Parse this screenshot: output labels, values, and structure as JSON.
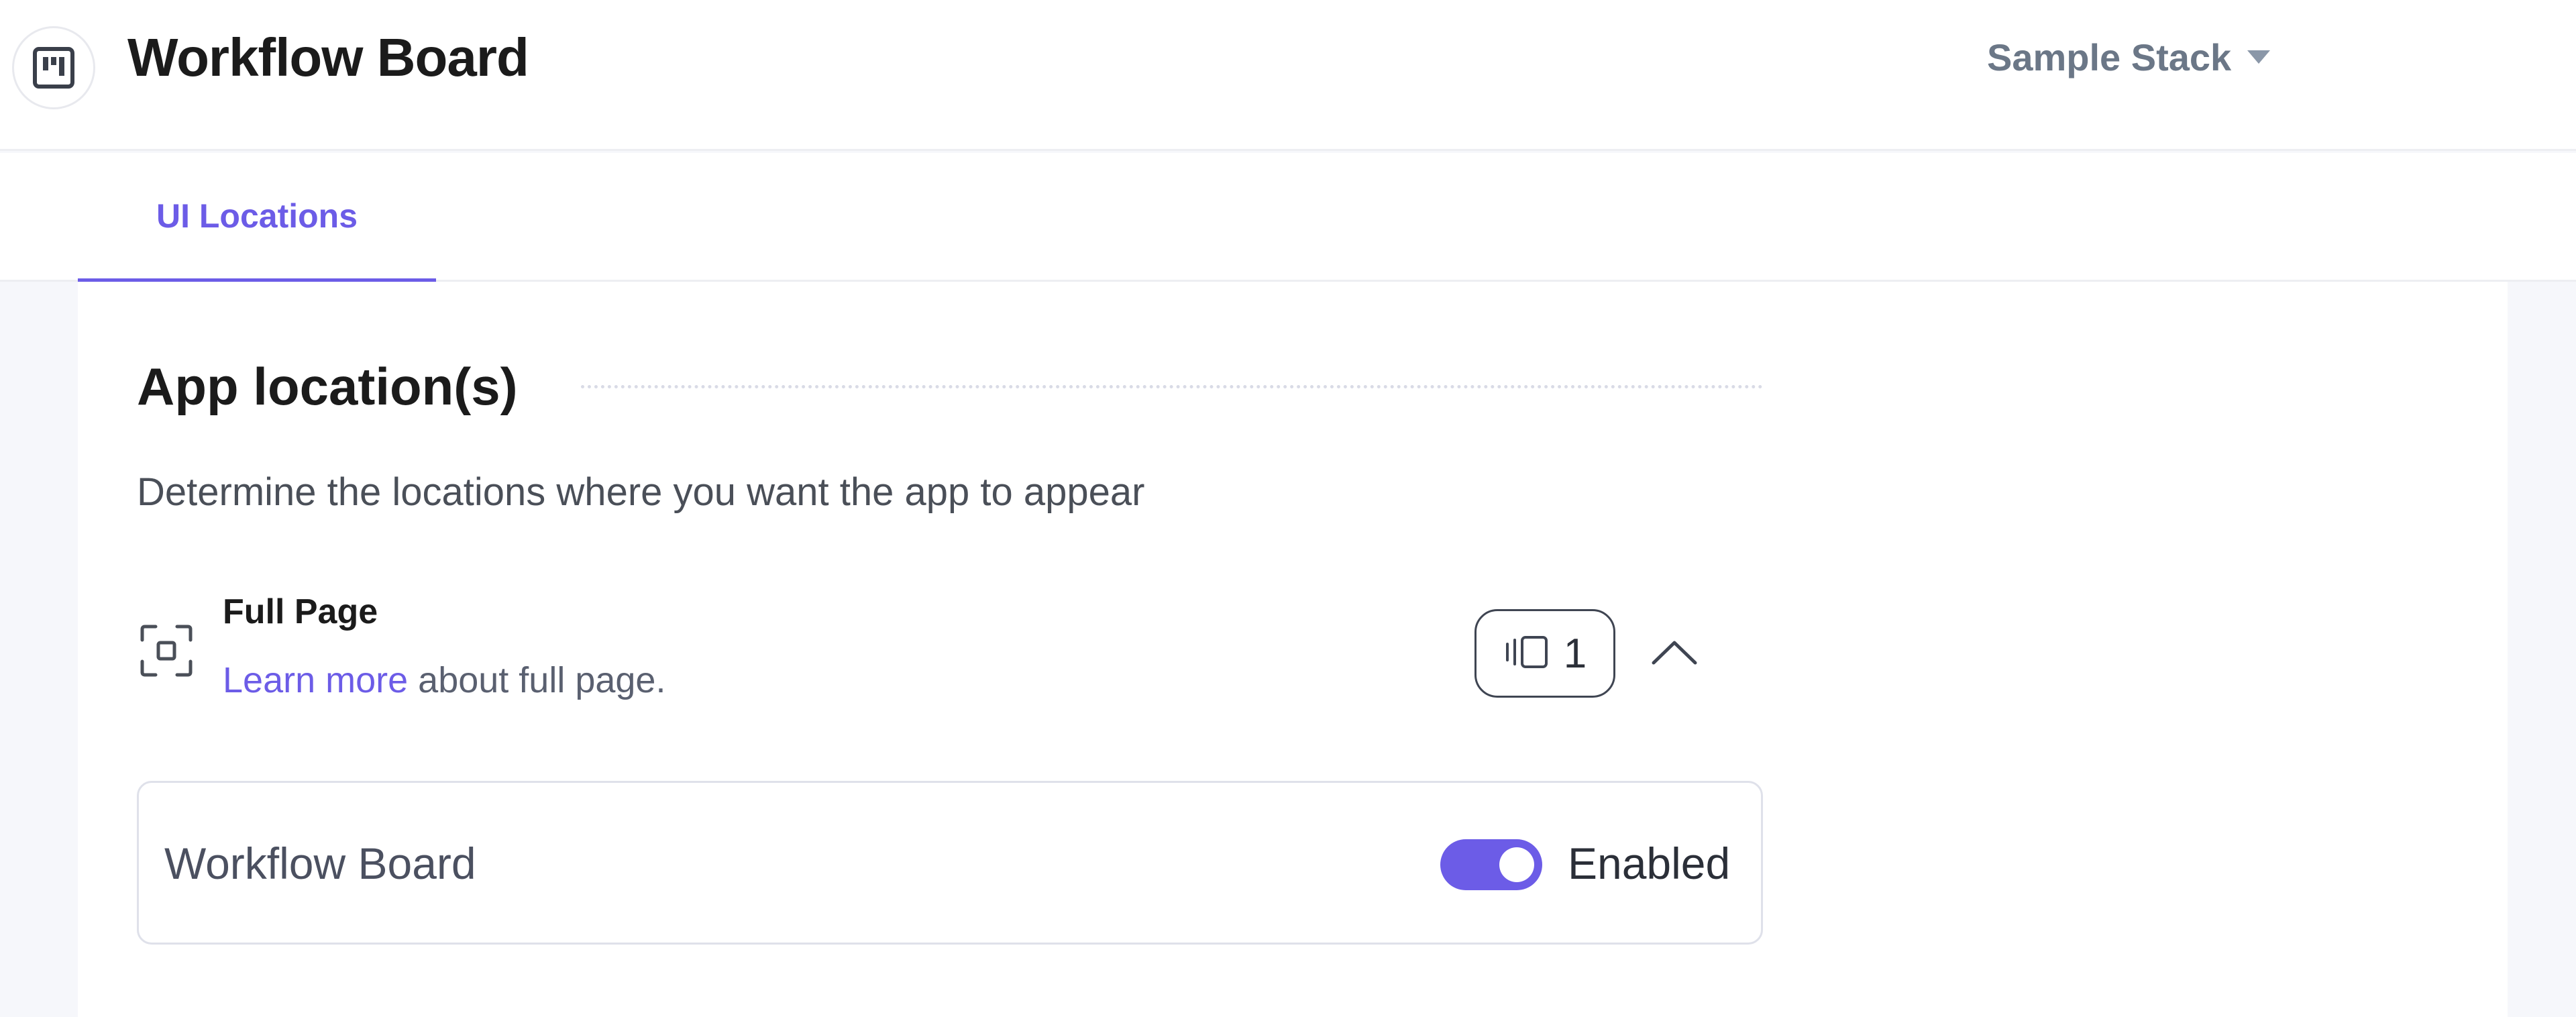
{
  "header": {
    "app_icon": "kanban-board-icon",
    "title": "Workflow Board",
    "stack_selector": {
      "label": "Sample Stack",
      "icon": "caret-down-icon"
    }
  },
  "tabs": [
    {
      "label": "UI Locations",
      "active": true
    }
  ],
  "section": {
    "title": "App location(s)",
    "description": "Determine the locations where you want the app to appear"
  },
  "location": {
    "icon": "full-page-frame-icon",
    "title": "Full Page",
    "link_text": "Learn more",
    "description_suffix": " about full page.",
    "count_icon": "panel-stack-icon",
    "count": "1",
    "collapse_icon": "chevron-up-icon",
    "expanded": true,
    "items": [
      {
        "name": "Workflow Board",
        "enabled": true,
        "status_label": "Enabled"
      }
    ]
  },
  "colors": {
    "accent": "#6c5ce7",
    "page_background": "#f6f7fb",
    "muted_text": "#6b7787"
  }
}
